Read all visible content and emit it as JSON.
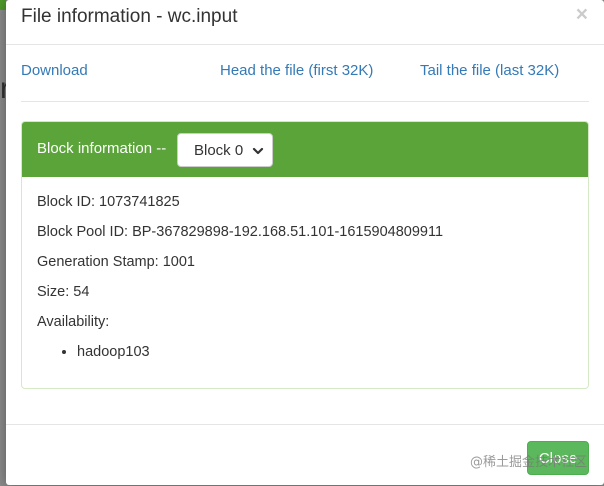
{
  "backdrop": {
    "partial_text": "r"
  },
  "modal": {
    "title": "File information - wc.input",
    "close_glyph": "×"
  },
  "links": {
    "download": "Download",
    "head": "Head the file (first 32K)",
    "tail": "Tail the file (last 32K)"
  },
  "block_panel": {
    "heading_label": "Block information --",
    "selected_block": "Block 0",
    "block_id": "Block ID: 1073741825",
    "block_pool_id": "Block Pool ID: BP-367829898-192.168.51.101-1615904809911",
    "generation_stamp": "Generation Stamp: 1001",
    "size": "Size: 54",
    "availability_label": "Availability:",
    "availability": [
      "hadoop103"
    ]
  },
  "footer": {
    "close_label": "Close"
  },
  "watermark": "@稀土掘金技术社区",
  "colors": {
    "panel_heading": "#5aa43a",
    "close_button": "#5cb85c",
    "link": "#337ab7"
  }
}
